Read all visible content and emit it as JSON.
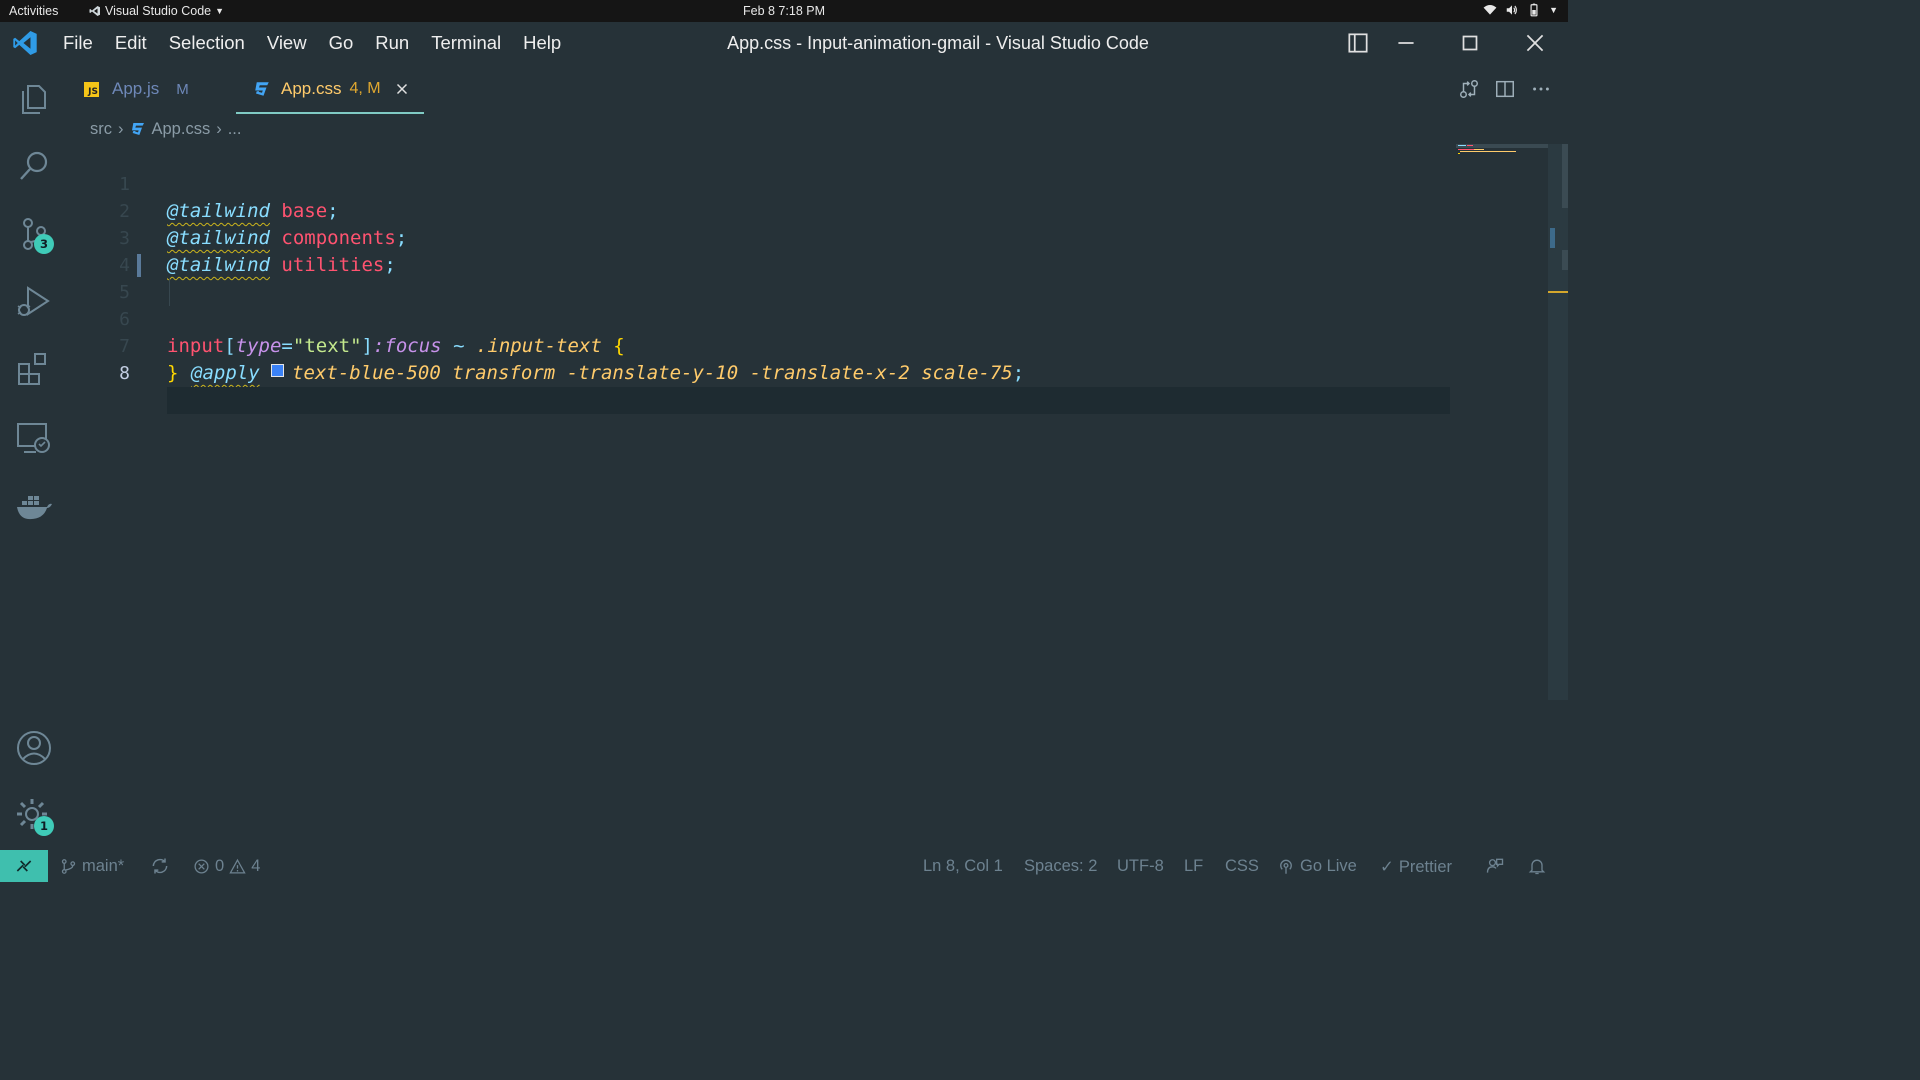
{
  "system_bar": {
    "activities": "Activities",
    "app_name": "Visual Studio Code",
    "datetime": "Feb 8  7:18 PM"
  },
  "menu": [
    "File",
    "Edit",
    "Selection",
    "View",
    "Go",
    "Run",
    "Terminal",
    "Help"
  ],
  "window_title": "App.css - Input-animation-gmail - Visual Studio Code",
  "activity_badges": {
    "source_control": "3",
    "settings": "1"
  },
  "tabs": [
    {
      "icon": "JS",
      "label": "App.js",
      "status": "M",
      "active": false
    },
    {
      "icon": "css-icon",
      "label": "App.css",
      "status": "4, M",
      "active": true
    }
  ],
  "breadcrumb": {
    "folder": "src",
    "file": "App.css",
    "more": "..."
  },
  "code": {
    "line_numbers": [
      "1",
      "2",
      "3",
      "4",
      "5",
      "6",
      "7",
      "8"
    ],
    "l1_at": "@tailwind",
    "l1_val": "base",
    "l2_at": "@tailwind",
    "l2_val": "components",
    "l3_at": "@tailwind",
    "l3_val": "utilities",
    "semi": ";",
    "l5_tag": "input",
    "l5_open_br": "[",
    "l5_attr": "type",
    "l5_eq": "=",
    "l5_str": "\"text\"",
    "l5_close_br": "]",
    "l5_pseudo": ":focus",
    "l5_comb": "~",
    "l5_cls": ".input-text",
    "l5_brace": "{",
    "l6_at": "@apply",
    "l6_utils": "text-blue-500 transform -translate-y-10 -translate-x-2 scale-75",
    "l6_semi": ";",
    "l7_brace": "}",
    "swatch_color": "#3b82f6"
  },
  "statusbar": {
    "branch": "main*",
    "errors": "0",
    "warnings": "4",
    "position": "Ln 8, Col 1",
    "spaces": "Spaces: 2",
    "encoding": "UTF-8",
    "eol": "LF",
    "language": "CSS",
    "golive": "Go Live",
    "prettier": "Prettier"
  },
  "colors": {
    "background": "#263238",
    "accent": "#80cbc4",
    "badge": "#3fcbb8"
  }
}
